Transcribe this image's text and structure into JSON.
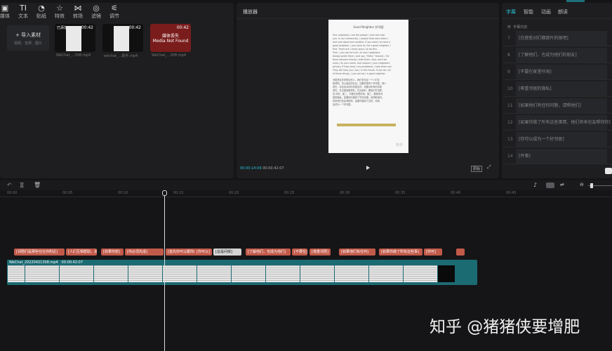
{
  "toolbar": {
    "items": [
      {
        "label": "媒体",
        "icon": "media-icon"
      },
      {
        "label": "文本",
        "icon": "text-icon"
      },
      {
        "label": "贴纸",
        "icon": "sticker-icon"
      },
      {
        "label": "特效",
        "icon": "effects-icon"
      },
      {
        "label": "转场",
        "icon": "transition-icon"
      },
      {
        "label": "滤镜",
        "icon": "filter-icon"
      },
      {
        "label": "调节",
        "icon": "adjust-icon"
      }
    ],
    "text_icon_glyph": "TI"
  },
  "media": {
    "import_label": "导入素材",
    "import_hint": "视频、音频、图片",
    "items": [
      {
        "duration": "00:42",
        "name": "WeChat_...308.mp4",
        "tag": "已添加"
      },
      {
        "duration": "00:42",
        "name": "wechat_...助手.mp4",
        "tag": ""
      },
      {
        "duration": "00:42",
        "name": "WeChat_...308.mp4",
        "missing_cn": "媒体丢失",
        "missing_en": "Media Not Found"
      }
    ]
  },
  "player": {
    "title": "播放器",
    "doc_title": "Good Neighbor 好邻居",
    "current_time": "00:00:14:06",
    "total_time": "00:00:42:07",
    "ratio_label": "原始",
    "doc_en_lines": [
      "Your neighbors / are the people / who live near",
      "you. In our community, / people help each other /",
      "and care about one another. If you want / to have a",
      "good neighbor, / you have to / be a good neighbor /",
      "first. There are / many ways / to do this.",
      "First, / you can be nice / to your neighbors.",
      "Always greet them / and say, \"Hello.\" Second, / let",
      "them become friends / with them. Also, don't be",
      "noisy / at your home. And respect / your neighbors'",
      "privacy. If they have / any problems, / help them out.",
      "They will help you / too / in the future. If you do / all",
      "of these things, / you can be / a good neighbor."
    ],
    "doc_cn_lines": [
      "邻居是住在你附近的人。我们在社区一个人们互",
      "相帮助，关心彼此的社区。如果你想有个好邻居，那么",
      "首先，你应该对你的邻居友好，你要对所有的邻居",
      "首先，在去做到那样的，在见面时，跟他们打招呼，",
      "说 你好，第二，不要在家里吵闹。第三，要尊重邻",
      "居的隐私。如果他们遇到了任何问题，就帮助他们。",
      "将来他们也会帮助你。如果你做到了这些，你就",
      "会成为一个好邻居。"
    ],
    "watermark": "知乎"
  },
  "subtitle_panel": {
    "tabs": [
      "字幕",
      "智能",
      "动画",
      "朗读"
    ],
    "header_num": "序",
    "header_text": "字幕内容",
    "rows": [
      {
        "num": "7",
        "text": "[在那些对们都那片的很吧]"
      },
      {
        "num": "8",
        "text": "[了解他们，也成为他们的朋友]"
      },
      {
        "num": "9",
        "text": "[不要在家里吵闹]"
      },
      {
        "num": "10",
        "text": "[尊重邻居的隐私]"
      },
      {
        "num": "11",
        "text": "[如果他们有任何问题，请帮他们]"
      },
      {
        "num": "12",
        "text": "[如果你做了所有这些事情，他们将来也会帮你你]"
      },
      {
        "num": "13",
        "text": "[你可以成为一个好邻居]"
      },
      {
        "num": "14",
        "text": "[件事]"
      }
    ]
  },
  "timeline": {
    "ticks": [
      "00:00",
      "00:05",
      "00:10",
      "00:15",
      "00:20",
      "00:25",
      "00:30",
      "00:35",
      "00:40",
      "00:45"
    ],
    "subtitles": [
      {
        "text": "[邻居们是那些住在你附近]",
        "sel": false
      },
      {
        "text": "[人们互相帮助，关心]",
        "sel": false
      },
      {
        "text": "[如果你想]",
        "sel": false
      },
      {
        "text": "[你必须先成]",
        "sel": false
      },
      {
        "text": "[首先你可以跟你的邻]",
        "sel": false
      },
      {
        "text": "[你可以]",
        "sel": false
      },
      {
        "text": "[总是问候]",
        "sel": true
      },
      {
        "text": "[了解他们，也成为他们]",
        "sel": false
      },
      {
        "text": "[不要在]",
        "sel": false
      },
      {
        "text": "[尊重邻居]",
        "sel": false
      },
      {
        "text": "[如果他们有任何]",
        "sel": false
      },
      {
        "text": "[如果你做了所有这些事]",
        "sel": false
      },
      {
        "text": "[你可]",
        "sel": false
      }
    ],
    "video_clip_name": "WeChat_20220421308.mp4",
    "video_clip_duration": "00:00:42:07"
  },
  "watermark": "知乎 @猪猪侠要增肥",
  "colors": {
    "accent": "#25c2d4",
    "subtitle_clip": "#c25a4a",
    "video_clip": "#1b6b73"
  }
}
